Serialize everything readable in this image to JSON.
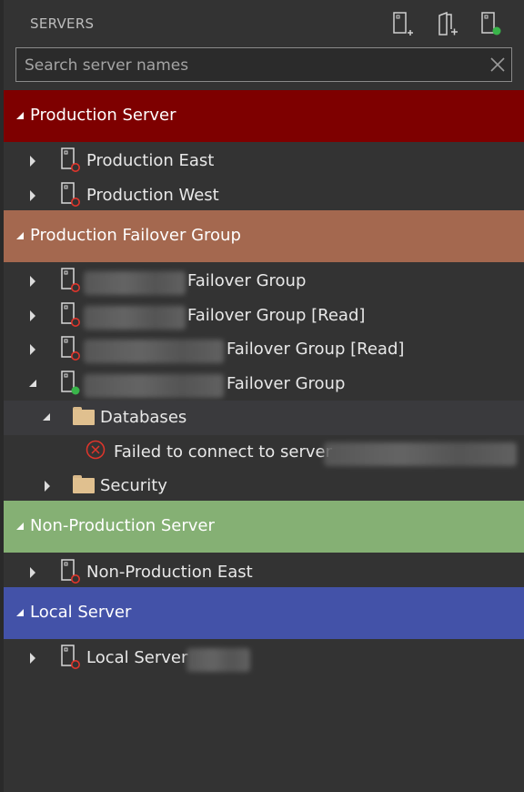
{
  "header": {
    "title": "SERVERS",
    "icons": [
      "new-server-icon",
      "new-server-group-icon",
      "active-connections-icon"
    ]
  },
  "search": {
    "placeholder": "Search server names",
    "value": ""
  },
  "colors": {
    "production": "#7e0000",
    "failover": "#a4684f",
    "nonproduction": "#85b074",
    "local": "#4352a8",
    "disconnected": "#e0352b",
    "connected": "#39b54a"
  },
  "groups": {
    "production": {
      "label": "Production Server",
      "servers": [
        {
          "label": "Production East",
          "status": "disconnected"
        },
        {
          "label": "Production West",
          "status": "disconnected"
        }
      ]
    },
    "failover": {
      "label": "Production Failover Group",
      "servers": [
        {
          "label": "Failover Group",
          "status": "disconnected"
        },
        {
          "label": "Failover Group [Read]",
          "status": "disconnected"
        },
        {
          "label": "Failover Group [Read]",
          "status": "disconnected"
        },
        {
          "label": "Failover Group",
          "status": "connected"
        }
      ],
      "children": {
        "databases": "Databases",
        "error": "Failed to connect to server",
        "security": "Security"
      }
    },
    "nonproduction": {
      "label": "Non-Production Server",
      "servers": [
        {
          "label": "Non-Production East",
          "status": "disconnected"
        }
      ]
    },
    "local": {
      "label": "Local Server",
      "servers": [
        {
          "label": "Local Server",
          "status": "disconnected"
        }
      ]
    }
  }
}
